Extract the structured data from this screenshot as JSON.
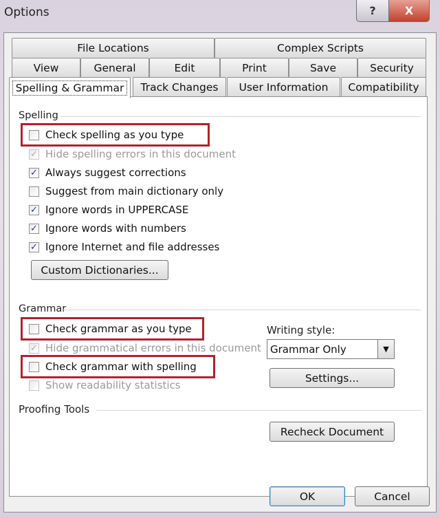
{
  "window": {
    "title": "Options",
    "help_label": "?",
    "close_label": "X"
  },
  "tabs": {
    "row1": [
      "File Locations",
      "Complex Scripts"
    ],
    "row2": [
      "View",
      "General",
      "Edit",
      "Print",
      "Save",
      "Security"
    ],
    "row3": [
      "Spelling & Grammar",
      "Track Changes",
      "User Information",
      "Compatibility"
    ],
    "selected": "Spelling & Grammar"
  },
  "spelling": {
    "label": "Spelling",
    "options": [
      {
        "label": "Check spelling as you type",
        "checked": false,
        "enabled": true,
        "highlighted": true
      },
      {
        "label": "Hide spelling errors in this document",
        "checked": true,
        "enabled": false
      },
      {
        "label": "Always suggest corrections",
        "checked": true,
        "enabled": true
      },
      {
        "label": "Suggest from main dictionary only",
        "checked": false,
        "enabled": true
      },
      {
        "label": "Ignore words in UPPERCASE",
        "checked": true,
        "enabled": true
      },
      {
        "label": "Ignore words with numbers",
        "checked": true,
        "enabled": true
      },
      {
        "label": "Ignore Internet and file addresses",
        "checked": true,
        "enabled": true
      }
    ],
    "custom_dictionaries": "Custom Dictionaries..."
  },
  "grammar": {
    "label": "Grammar",
    "options": [
      {
        "label": "Check grammar as you type",
        "checked": false,
        "enabled": true,
        "highlighted": true
      },
      {
        "label": "Hide grammatical errors in this document",
        "checked": true,
        "enabled": false
      },
      {
        "label": "Check grammar with spelling",
        "checked": false,
        "enabled": true,
        "highlighted": true
      },
      {
        "label": "Show readability statistics",
        "checked": false,
        "enabled": false
      }
    ],
    "writing_style_label": "Writing style:",
    "writing_style_value": "Grammar Only",
    "settings": "Settings..."
  },
  "proofing": {
    "label": "Proofing Tools",
    "recheck": "Recheck Document"
  },
  "footer": {
    "ok": "OK",
    "cancel": "Cancel"
  },
  "colors": {
    "highlight": "#b5202a"
  }
}
